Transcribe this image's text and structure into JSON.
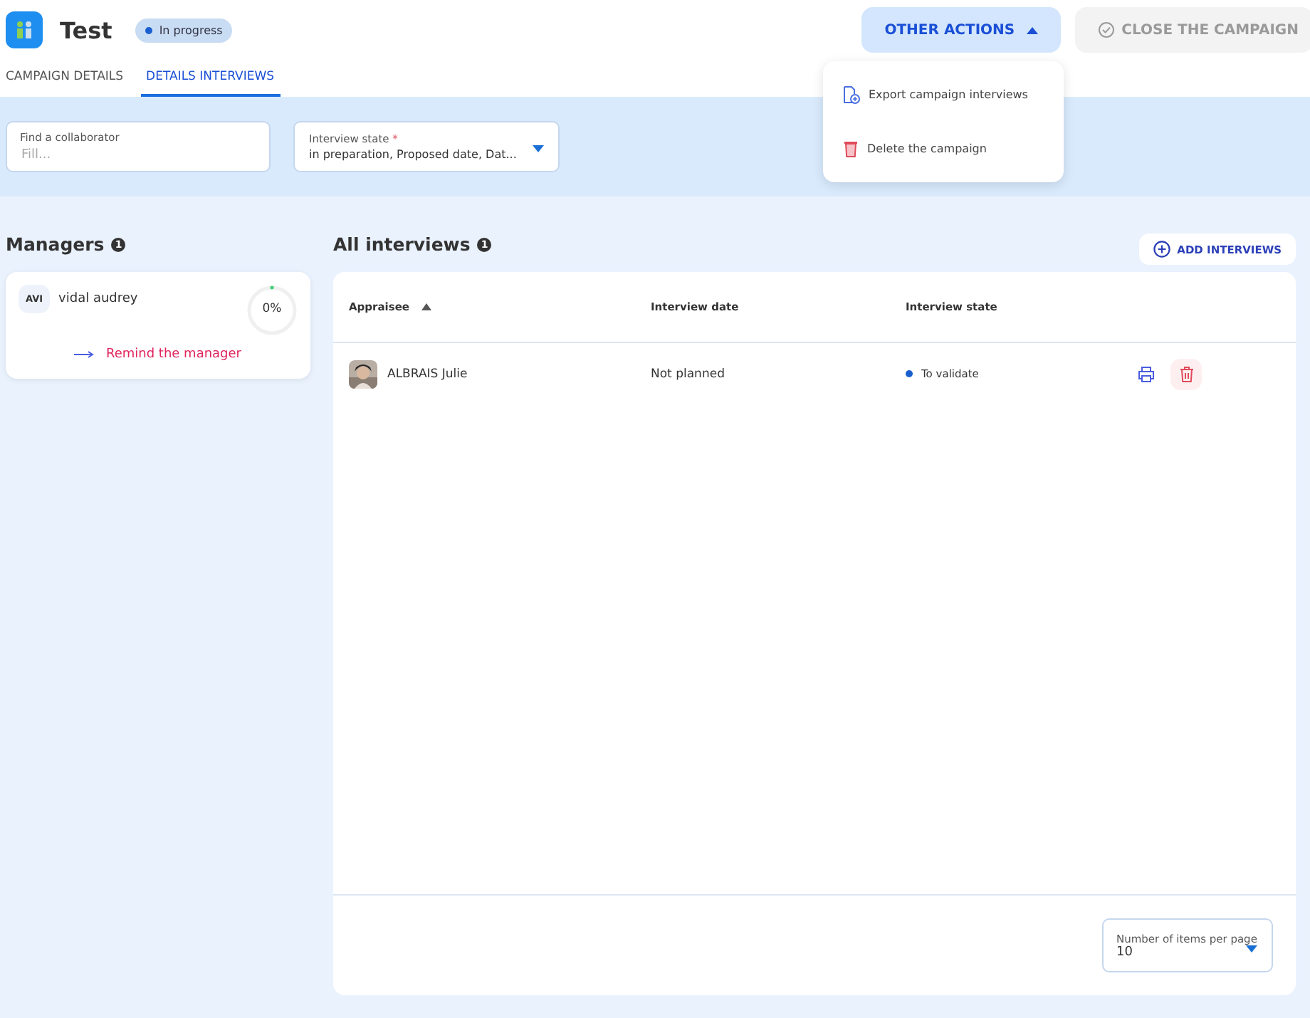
{
  "header": {
    "title": "Test",
    "status": "In progress",
    "other_actions": {
      "label": "OTHER ACTIONS",
      "expanded": true
    },
    "close_button": {
      "label": "CLOSE THE CAMPAIGN",
      "disabled": true
    }
  },
  "menu": [
    {
      "kind": "export",
      "label": "Export campaign interviews"
    },
    {
      "kind": "delete",
      "label": "Delete the campaign"
    }
  ],
  "tabs": [
    {
      "label": "CAMPAIGN DETAILS",
      "selected": false
    },
    {
      "label": "DETAILS INTERVIEWS",
      "selected": true
    }
  ],
  "filters": {
    "collaborator": {
      "label": "Find a collaborator",
      "placeholder": "Fill..."
    },
    "state": {
      "label": "Interview state",
      "required_mark": "*",
      "value": "in preparation, Proposed date, Dat..."
    }
  },
  "managers": {
    "title": "Managers",
    "count": "1",
    "items": [
      {
        "initials": "AVI",
        "name": "vidal audrey",
        "progress": "0%",
        "level": 0,
        "action": "Remind the manager"
      }
    ]
  },
  "interviews": {
    "title": "All interviews",
    "count": "1",
    "add_button": "ADD INTERVIEWS",
    "columns": [
      {
        "label": "Appraisee",
        "sorted": true
      },
      {
        "label": "Interview date",
        "sorted": false
      },
      {
        "label": "Interview state",
        "sorted": false
      }
    ],
    "rows": [
      {
        "name": "ALBRAIS Julie",
        "date": "Not planned",
        "state": "To validate"
      }
    ],
    "page_size": {
      "label": "Number of items per page",
      "value": "10"
    }
  }
}
